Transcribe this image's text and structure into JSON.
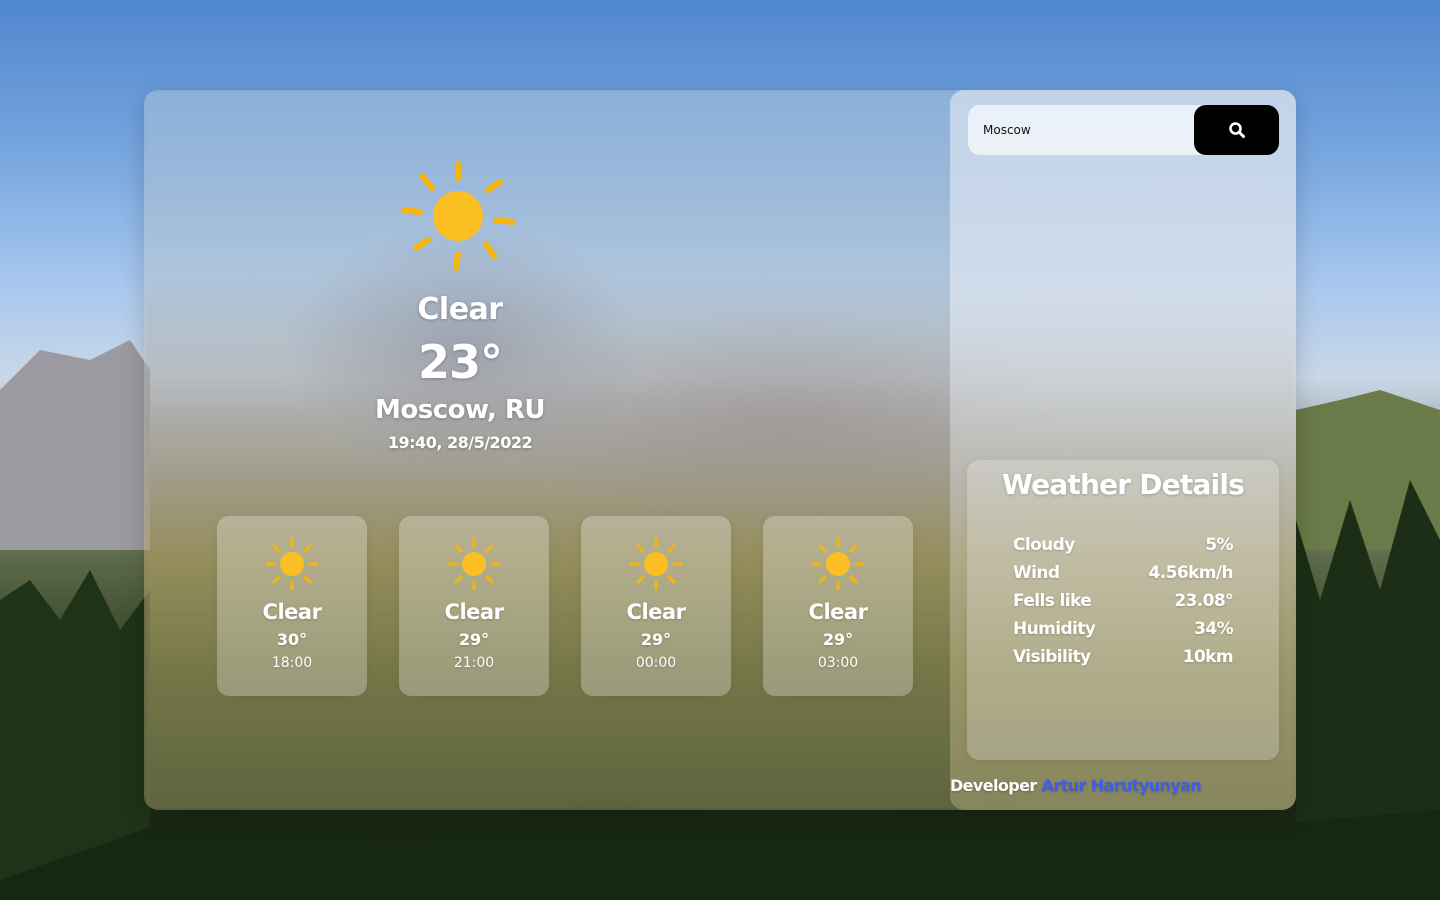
{
  "current": {
    "condition": "Clear",
    "temperature": "23°",
    "city": "Moscow, RU",
    "datetime": "19:40, 28/5/2022",
    "icon": "sun-icon"
  },
  "forecast": [
    {
      "condition": "Clear",
      "temperature": "30°",
      "time": "18:00",
      "icon": "sun-icon"
    },
    {
      "condition": "Clear",
      "temperature": "29°",
      "time": "21:00",
      "icon": "sun-icon"
    },
    {
      "condition": "Clear",
      "temperature": "29°",
      "time": "00:00",
      "icon": "sun-icon"
    },
    {
      "condition": "Clear",
      "temperature": "29°",
      "time": "03:00",
      "icon": "sun-icon"
    }
  ],
  "search": {
    "value": "Moscow",
    "button_icon": "search-icon"
  },
  "details": {
    "title": "Weather Details",
    "rows": [
      {
        "label": "Cloudy",
        "value": "5%"
      },
      {
        "label": "Wind",
        "value": "4.56km/h"
      },
      {
        "label": "Fells like",
        "value": "23.08°"
      },
      {
        "label": "Humidity",
        "value": "34%"
      },
      {
        "label": "Visibility",
        "value": "10km"
      }
    ]
  },
  "footer": {
    "developer_label": "Developer",
    "developer_name": "Artur Harutyunyan"
  },
  "colors": {
    "sun": "#fbbf24",
    "sun_rays": "#f5b50a",
    "search_button": "#000000",
    "developer_link": "#3e5ee6"
  }
}
